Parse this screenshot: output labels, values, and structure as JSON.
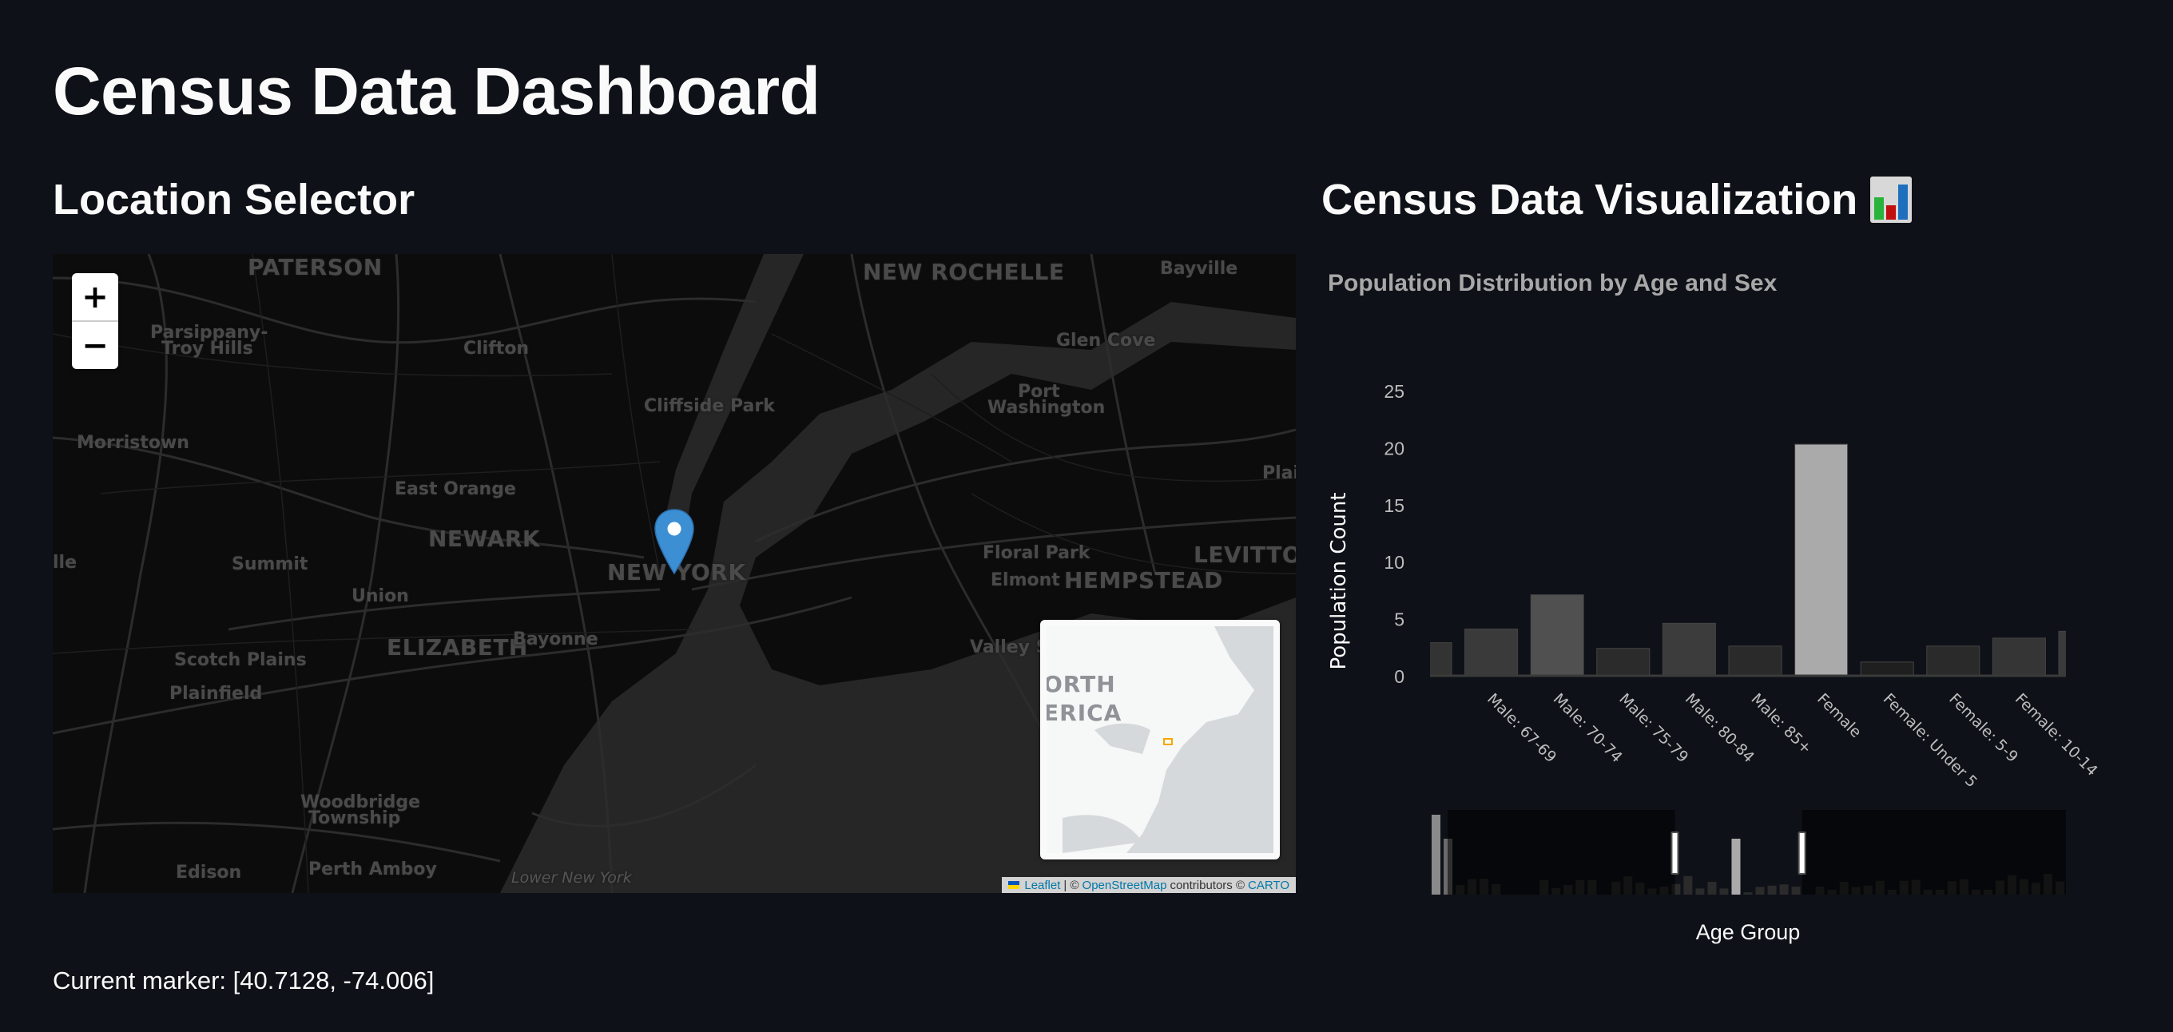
{
  "page": {
    "title": "Census Data Dashboard"
  },
  "location_selector": {
    "title": "Location Selector",
    "zoom_in_label": "+",
    "zoom_out_label": "−",
    "map_labels": [
      {
        "text": "PATERSON",
        "kind": "big"
      },
      {
        "text": "NEW ROCHELLE",
        "kind": "big"
      },
      {
        "text": "Bayville",
        "kind": "city"
      },
      {
        "text": "Parsippany-",
        "kind": "city"
      },
      {
        "text": "Troy Hills",
        "kind": "city"
      },
      {
        "text": "Clifton",
        "kind": "city"
      },
      {
        "text": "Glen Cove",
        "kind": "city"
      },
      {
        "text": "Cliffside Park",
        "kind": "city"
      },
      {
        "text": "Port",
        "kind": "city"
      },
      {
        "text": "Washington",
        "kind": "city"
      },
      {
        "text": "Morristown",
        "kind": "city"
      },
      {
        "text": "East Orange",
        "kind": "city"
      },
      {
        "text": "Plai",
        "kind": "city"
      },
      {
        "text": "NEWARK",
        "kind": "big"
      },
      {
        "text": "NEW YORK",
        "kind": "big"
      },
      {
        "text": "Floral Park",
        "kind": "city"
      },
      {
        "text": "LEVITTOWN",
        "kind": "big"
      },
      {
        "text": "lle",
        "kind": "city"
      },
      {
        "text": "Summit",
        "kind": "city"
      },
      {
        "text": "Elmont",
        "kind": "city"
      },
      {
        "text": "HEMPSTEAD",
        "kind": "big"
      },
      {
        "text": "Union",
        "kind": "city"
      },
      {
        "text": "ELIZABETH",
        "kind": "big"
      },
      {
        "text": "Bayonne",
        "kind": "city"
      },
      {
        "text": "Valley Str",
        "kind": "city"
      },
      {
        "text": "Scotch Plains",
        "kind": "city"
      },
      {
        "text": "Plainfield",
        "kind": "city"
      },
      {
        "text": "Woodbridge",
        "kind": "city"
      },
      {
        "text": "Township",
        "kind": "city"
      },
      {
        "text": "Edison",
        "kind": "city"
      },
      {
        "text": "Perth Amboy",
        "kind": "city"
      },
      {
        "text": "Lower New York",
        "kind": "water"
      }
    ],
    "minimap_labels": [
      "ORTH",
      "ERICA"
    ],
    "attribution": {
      "leaflet": "Leaflet",
      "separator": "| ©",
      "osm": "OpenStreetMap",
      "contributors": "contributors ©",
      "carto": "CARTO"
    },
    "marker_text": "Current marker: [40.7128, -74.006]",
    "marker": {
      "lat": 40.7128,
      "lng": -74.006
    }
  },
  "visualization": {
    "title": "Census Data Visualization",
    "title_icon": "bar-chart-emoji"
  },
  "chart_data": {
    "type": "bar",
    "title": "Population Distribution by Age and Sex",
    "xlabel": "Age Group",
    "ylabel": "Population Count",
    "ylim": [
      0,
      25
    ],
    "yticks": [
      0,
      5,
      10,
      15,
      20,
      25
    ],
    "grid": false,
    "categories": [
      "",
      "Male: 67-69",
      "Male: 70-74",
      "Male: 75-79",
      "Male: 80-84",
      "Male: 85+",
      "Female",
      "Female: Under 5",
      "Female: 5-9",
      "Female: 10-14",
      ""
    ],
    "values": [
      2.9,
      4.1,
      7.1,
      2.4,
      4.6,
      2.6,
      20.3,
      1.2,
      2.6,
      3.3,
      3.9
    ],
    "bar_shades": [
      "#333333",
      "#3a3a3a",
      "#505050",
      "#2b2b2b",
      "#3c3c3c",
      "#2a2a2a",
      "#aaaaaa",
      "#1f1f1f",
      "#2a2a2a",
      "#353535",
      "#3a3a3a"
    ],
    "range_slider": {
      "values": [
        25,
        17.5,
        3,
        4.8,
        5,
        3.3,
        0,
        0,
        0,
        4.5,
        2,
        3,
        4.5,
        4.5,
        0,
        4,
        5.7,
        3.8,
        1.9,
        2.5,
        3.3,
        5.8,
        1.9,
        4,
        1.9,
        17.5,
        0.7,
        2.4,
        2.8,
        3.2,
        2.5,
        0,
        2.5,
        1.5,
        4,
        2.4,
        2.8,
        4.3,
        1.5,
        4.3,
        4.6,
        1.5,
        1.5,
        4.2,
        4.8,
        1.5,
        1.5,
        4.4,
        6.1,
        4.8,
        3.7,
        6.5,
        4.1
      ],
      "selected_range": [
        0.385,
        0.585
      ]
    }
  }
}
